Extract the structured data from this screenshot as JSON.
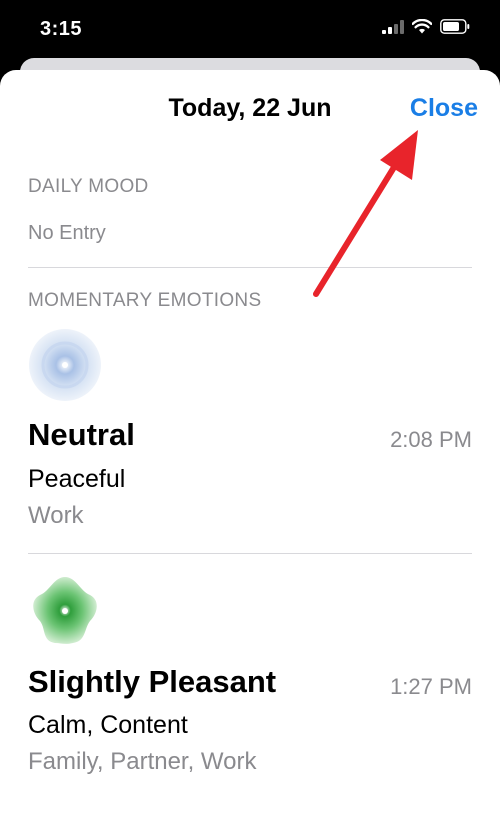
{
  "status_bar": {
    "time": "3:15"
  },
  "sheet": {
    "title": "Today, 22 Jun",
    "close_label": "Close"
  },
  "daily_mood": {
    "label": "DAILY MOOD",
    "value": "No Entry"
  },
  "momentary": {
    "label": "MOMENTARY EMOTIONS",
    "entries": [
      {
        "mood": "Neutral",
        "time": "2:08 PM",
        "feelings": "Peaceful",
        "context": "Work",
        "icon": "neutral-mood-icon",
        "color": "#b9cdea"
      },
      {
        "mood": "Slightly Pleasant",
        "time": "1:27 PM",
        "feelings": "Calm, Content",
        "context": "Family, Partner, Work",
        "icon": "slightly-pleasant-mood-icon",
        "color": "#4fbd5a"
      }
    ]
  },
  "colors": {
    "accent": "#1a7ee6",
    "annotation_arrow": "#e8242b"
  }
}
